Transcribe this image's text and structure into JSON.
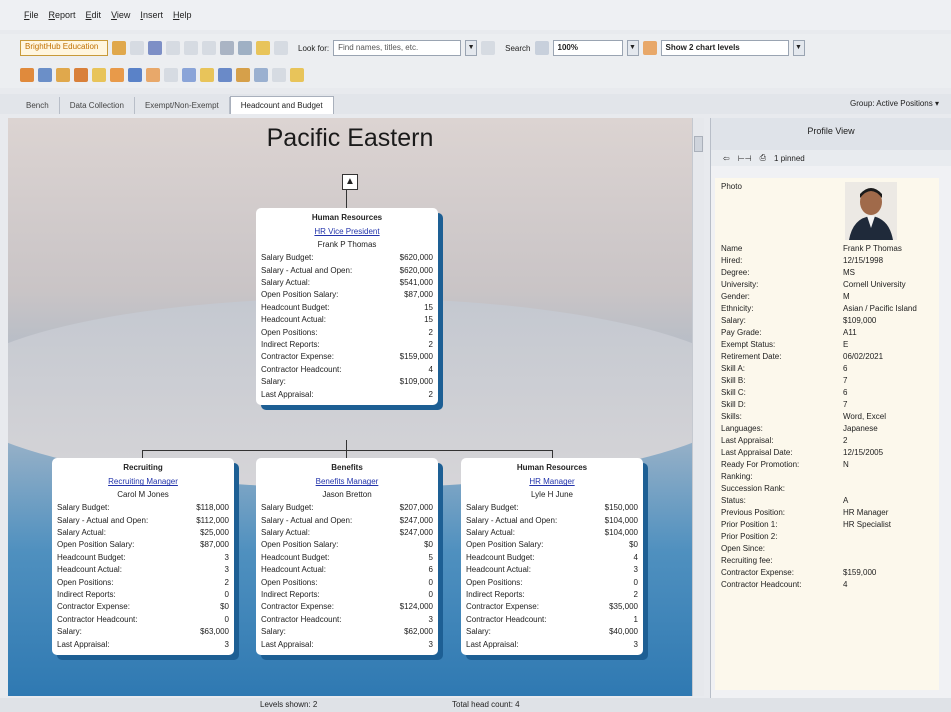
{
  "menu": [
    "File",
    "Report",
    "Edit",
    "View",
    "Insert",
    "Help"
  ],
  "toolbar": {
    "org_field": "BrightHub Education",
    "lookfor_label": "Look for:",
    "search_placeholder": "Find names, titles, etc.",
    "search_label": "Search",
    "zoom": "100%",
    "levels": "Show 2 chart levels"
  },
  "tabs": [
    "Bench",
    "Data Collection",
    "Exempt/Non-Exempt",
    "Headcount and Budget"
  ],
  "group_label": "Group: Active Positions",
  "chart": {
    "title": "Pacific Eastern",
    "root": {
      "dept": "Human Resources",
      "role": "HR Vice President",
      "person": "Frank P Thomas",
      "fields": [
        [
          "Salary Budget:",
          "$620,000"
        ],
        [
          "Salary - Actual and Open:",
          "$620,000"
        ],
        [
          "Salary Actual:",
          "$541,000"
        ],
        [
          "Open Position Salary:",
          "$87,000"
        ],
        [
          "Headcount Budget:",
          "15"
        ],
        [
          "Headcount Actual:",
          "15"
        ],
        [
          "Open Positions:",
          "2"
        ],
        [
          "Indirect Reports:",
          "2"
        ],
        [
          "Contractor Expense:",
          "$159,000"
        ],
        [
          "Contractor Headcount:",
          "4"
        ],
        [
          "Salary:",
          "$109,000"
        ],
        [
          "Last Appraisal:",
          "2"
        ]
      ]
    },
    "children": [
      {
        "dept": "Recruiting",
        "role": "Recruiting Manager",
        "person": "Carol M Jones",
        "fields": [
          [
            "Salary Budget:",
            "$118,000"
          ],
          [
            "Salary - Actual and Open:",
            "$112,000"
          ],
          [
            "Salary Actual:",
            "$25,000"
          ],
          [
            "Open Position Salary:",
            "$87,000"
          ],
          [
            "Headcount Budget:",
            "3"
          ],
          [
            "Headcount Actual:",
            "3"
          ],
          [
            "Open Positions:",
            "2"
          ],
          [
            "Indirect Reports:",
            "0"
          ],
          [
            "Contractor Expense:",
            "$0"
          ],
          [
            "Contractor Headcount:",
            "0"
          ],
          [
            "Salary:",
            "$63,000"
          ],
          [
            "Last Appraisal:",
            "3"
          ]
        ]
      },
      {
        "dept": "Benefits",
        "role": "Benefits Manager",
        "person": "Jason Bretton",
        "fields": [
          [
            "Salary Budget:",
            "$207,000"
          ],
          [
            "Salary - Actual and Open:",
            "$247,000"
          ],
          [
            "Salary Actual:",
            "$247,000"
          ],
          [
            "Open Position Salary:",
            "$0"
          ],
          [
            "Headcount Budget:",
            "5"
          ],
          [
            "Headcount Actual:",
            "6"
          ],
          [
            "Open Positions:",
            "0"
          ],
          [
            "Indirect Reports:",
            "0"
          ],
          [
            "Contractor Expense:",
            "$124,000"
          ],
          [
            "Contractor Headcount:",
            "3"
          ],
          [
            "Salary:",
            "$62,000"
          ],
          [
            "Last Appraisal:",
            "3"
          ]
        ]
      },
      {
        "dept": "Human Resources",
        "role": "HR Manager",
        "person": "Lyle H June",
        "fields": [
          [
            "Salary Budget:",
            "$150,000"
          ],
          [
            "Salary - Actual and Open:",
            "$104,000"
          ],
          [
            "Salary Actual:",
            "$104,000"
          ],
          [
            "Open Position Salary:",
            "$0"
          ],
          [
            "Headcount Budget:",
            "4"
          ],
          [
            "Headcount Actual:",
            "3"
          ],
          [
            "Open Positions:",
            "0"
          ],
          [
            "Indirect Reports:",
            "2"
          ],
          [
            "Contractor Expense:",
            "$35,000"
          ],
          [
            "Contractor Headcount:",
            "1"
          ],
          [
            "Salary:",
            "$40,000"
          ],
          [
            "Last Appraisal:",
            "3"
          ]
        ]
      }
    ]
  },
  "status": {
    "levels_shown": "Levels shown: 2",
    "head_count": "Total head count: 4"
  },
  "profile": {
    "title": "Profile View",
    "pinned": "1 pinned",
    "photo_label": "Photo",
    "fields": [
      [
        "Name",
        "Frank P Thomas"
      ],
      [
        "Hired:",
        "12/15/1998"
      ],
      [
        "Degree:",
        "MS"
      ],
      [
        "University:",
        "Cornell University"
      ],
      [
        "Gender:",
        "M"
      ],
      [
        "Ethnicity:",
        "Asian / Pacific Island"
      ],
      [
        "Salary:",
        "$109,000"
      ],
      [
        "Pay Grade:",
        "A11"
      ],
      [
        "Exempt Status:",
        "E"
      ],
      [
        "Retirement Date:",
        "06/02/2021"
      ],
      [
        "Skill A:",
        "6"
      ],
      [
        "Skill B:",
        "7"
      ],
      [
        "Skill C:",
        "6"
      ],
      [
        "Skill D:",
        "7"
      ],
      [
        "Skills:",
        "Word, Excel"
      ],
      [
        "Languages:",
        "Japanese"
      ],
      [
        "Last Appraisal:",
        "2"
      ],
      [
        "Last Appraisal Date:",
        "12/15/2005"
      ],
      [
        "Ready For Promotion:",
        "N"
      ],
      [
        "Ranking:",
        ""
      ],
      [
        "Succession Rank:",
        ""
      ],
      [
        "Status:",
        "A"
      ],
      [
        "Previous Position:",
        "HR Manager"
      ],
      [
        "Prior Position 1:",
        "HR Specialist"
      ],
      [
        "Prior Position 2:",
        ""
      ],
      [
        "Open Since:",
        ""
      ],
      [
        "Recruiting fee:",
        ""
      ],
      [
        "Contractor Expense:",
        "$159,000"
      ],
      [
        "Contractor Headcount:",
        "4"
      ]
    ]
  },
  "colors": {
    "card_shadow": "#1d5f94",
    "accent_orange": "#c07000"
  }
}
